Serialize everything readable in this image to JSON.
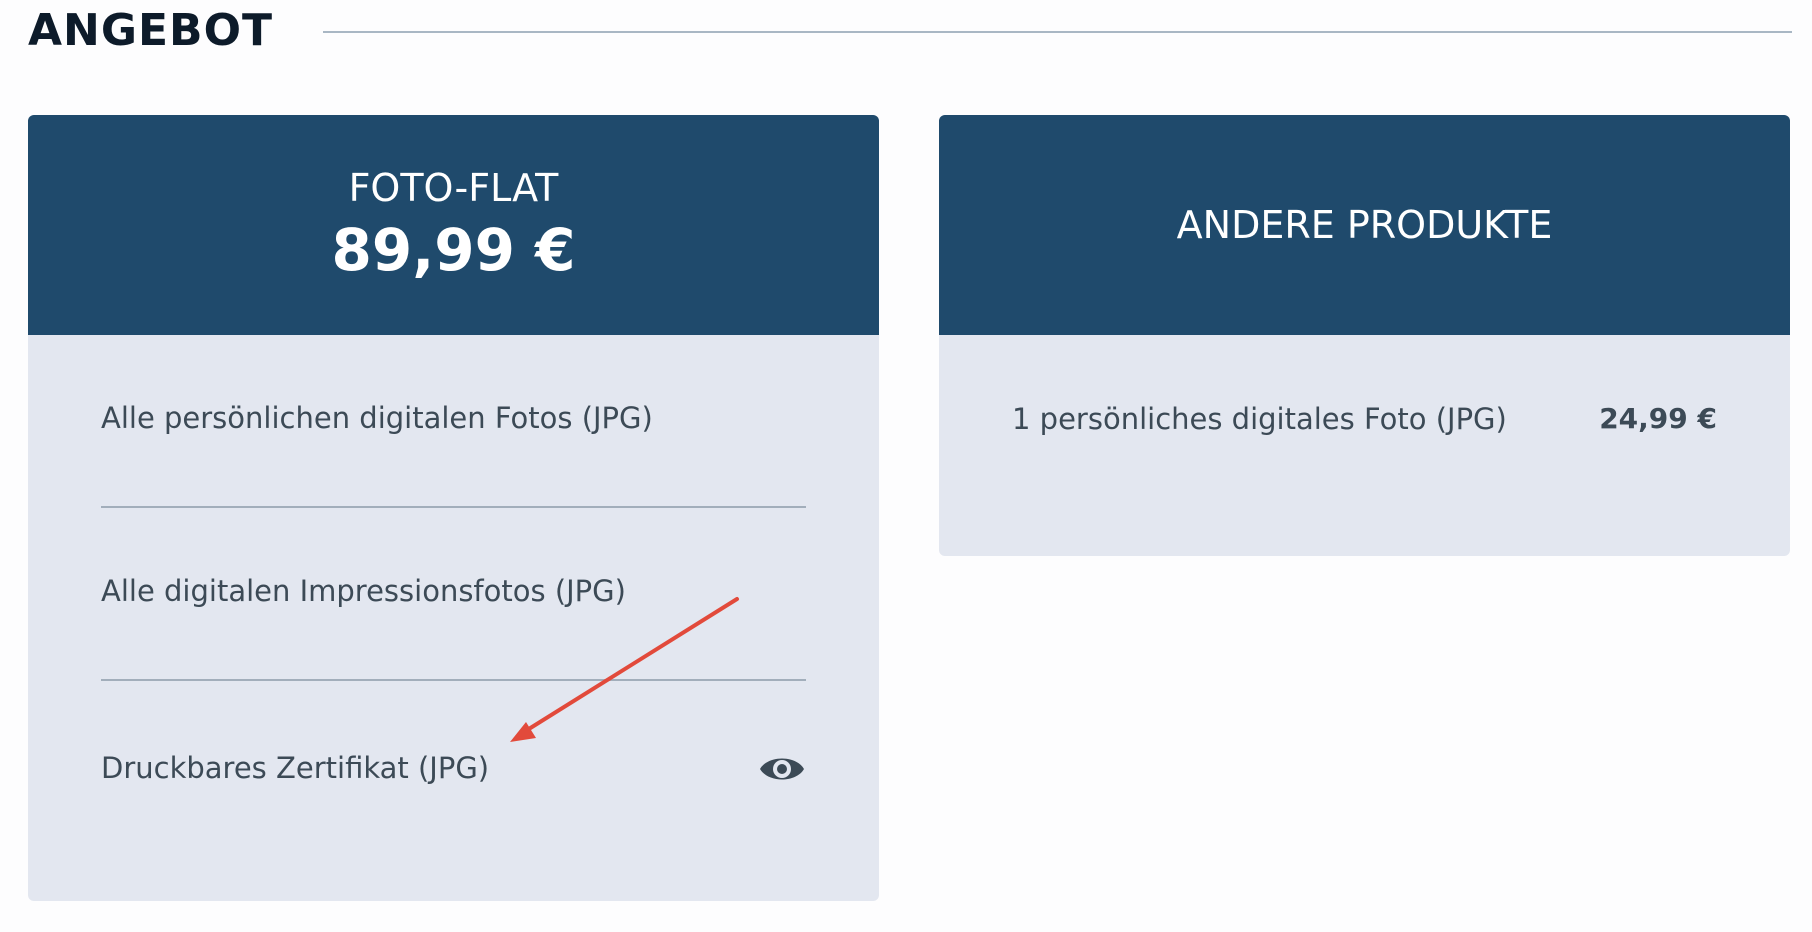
{
  "section": {
    "title": "ANGEBOT"
  },
  "flat_offer": {
    "name": "FOTO-FLAT",
    "price": "89,99 €",
    "features": [
      {
        "label": "Alle persönlichen digitalen Fotos (JPG)"
      },
      {
        "label": "Alle digitalen Impressionsfotos (JPG)"
      },
      {
        "label": "Druckbares Zertifikat (JPG)",
        "icon": "eye-icon"
      }
    ]
  },
  "other_products": {
    "title": "ANDERE PRODUKTE",
    "items": [
      {
        "label": "1 persönliches digitales Foto (JPG)",
        "price": "24,99 €"
      }
    ]
  },
  "colors": {
    "header_blue": "#1f4a6c",
    "card_background": "#e3e7f0",
    "annotation_arrow": "#e24a3b"
  }
}
